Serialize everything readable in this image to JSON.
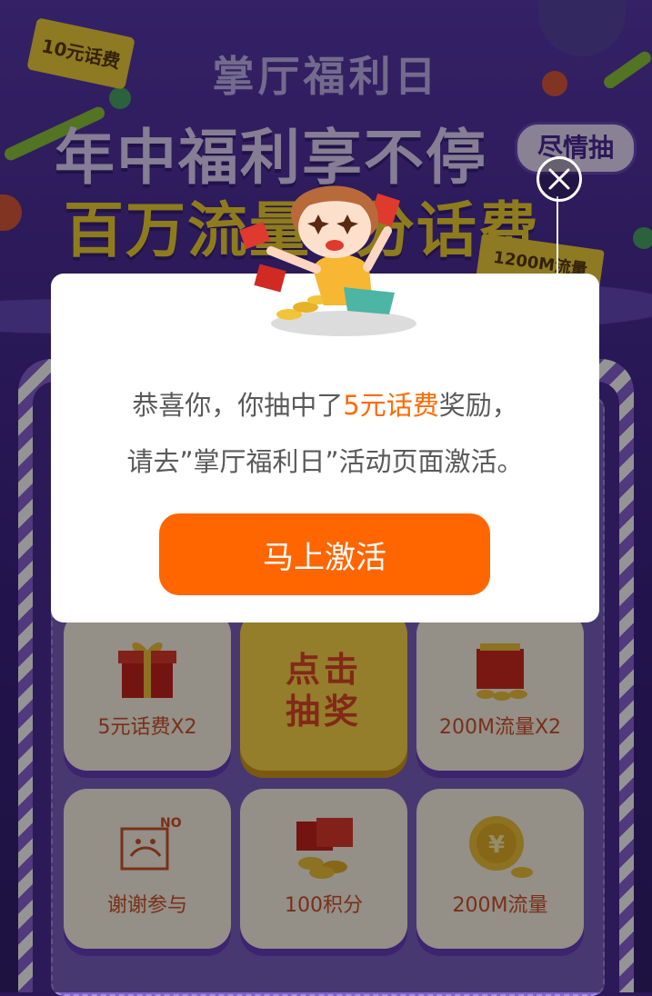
{
  "banner": {
    "tag_10": "10元话费",
    "subtitle": "掌厅福利日",
    "title_line1": "年中福利享不停",
    "title_line2": "百万流量0分话费",
    "tag_lottery": "尽情抽",
    "tag_1200": "1200M流量"
  },
  "grid": {
    "cells": [
      {
        "label": "5元话费X2",
        "icon": "gift-box-icon"
      },
      {
        "label": "200M流量X2",
        "icon": "red-envelope-coins-icon"
      },
      {
        "label": "谢谢参与",
        "icon": "thanks-no-icon"
      },
      {
        "label": "100积分",
        "icon": "coins-envelope-icon"
      },
      {
        "label": "200M流量",
        "icon": "gold-coin-icon"
      }
    ],
    "draw_button": "点击抽奖"
  },
  "modal": {
    "message_prefix": "恭喜你，你抽中了",
    "prize": "5元话费",
    "message_suffix": "奖励，",
    "message_line2": "请去”掌厅福利日”活动页面激活。",
    "activate_button": "马上激活",
    "close_icon": "close-icon",
    "mascot": "celebrating-girl-mascot"
  },
  "colors": {
    "accent": "#ff6600",
    "highlight": "#ff6a00",
    "text": "#5a5a5a"
  }
}
